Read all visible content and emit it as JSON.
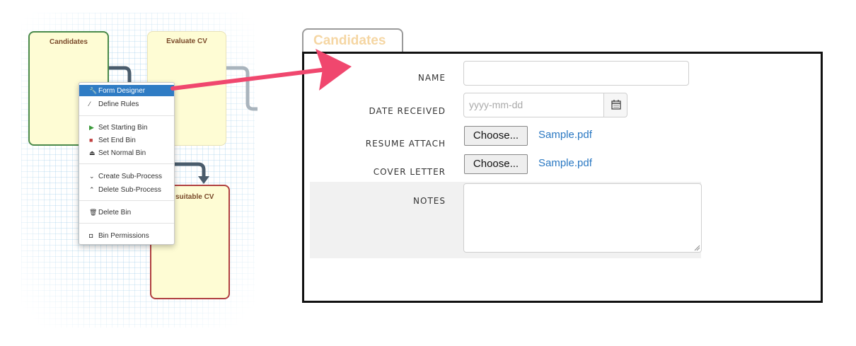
{
  "process_map": {
    "bins": {
      "candidates": "Candidates",
      "evaluate": "Evaluate CV",
      "unsuitable": "suitable CV"
    }
  },
  "context_menu": {
    "items": [
      {
        "label": "Form Designer",
        "icon": "wrench-icon"
      },
      {
        "label": "Define Rules",
        "icon": "wand-icon"
      },
      {
        "label": "Set Starting Bin",
        "icon": "play-icon"
      },
      {
        "label": "Set End Bin",
        "icon": "stop-icon"
      },
      {
        "label": "Set Normal Bin",
        "icon": "eject-icon"
      },
      {
        "label": "Create Sub-Process",
        "icon": "chevron-down-icon"
      },
      {
        "label": "Delete Sub-Process",
        "icon": "chevron-up-icon"
      },
      {
        "label": "Delete Bin",
        "icon": "trash-icon"
      },
      {
        "label": "Bin Permissions",
        "icon": "shield-icon"
      }
    ]
  },
  "form": {
    "tab_title": "Candidates",
    "fields": {
      "name_label": "NAME",
      "name_value": "",
      "date_label": "DATE RECEIVED",
      "date_placeholder": "yyyy-mm-dd",
      "resume_label": "RESUME ATTACH",
      "resume_button": "Choose...",
      "resume_file": "Sample.pdf",
      "cover_label": "COVER LETTER",
      "cover_button": "Choose...",
      "cover_file": "Sample.pdf",
      "notes_label": "NOTES",
      "notes_value": ""
    }
  },
  "colors": {
    "menu_active": "#2f7cc4",
    "arrow": "#f0476e",
    "tab_title": "#f5d6a3",
    "link": "#2a78c2"
  }
}
